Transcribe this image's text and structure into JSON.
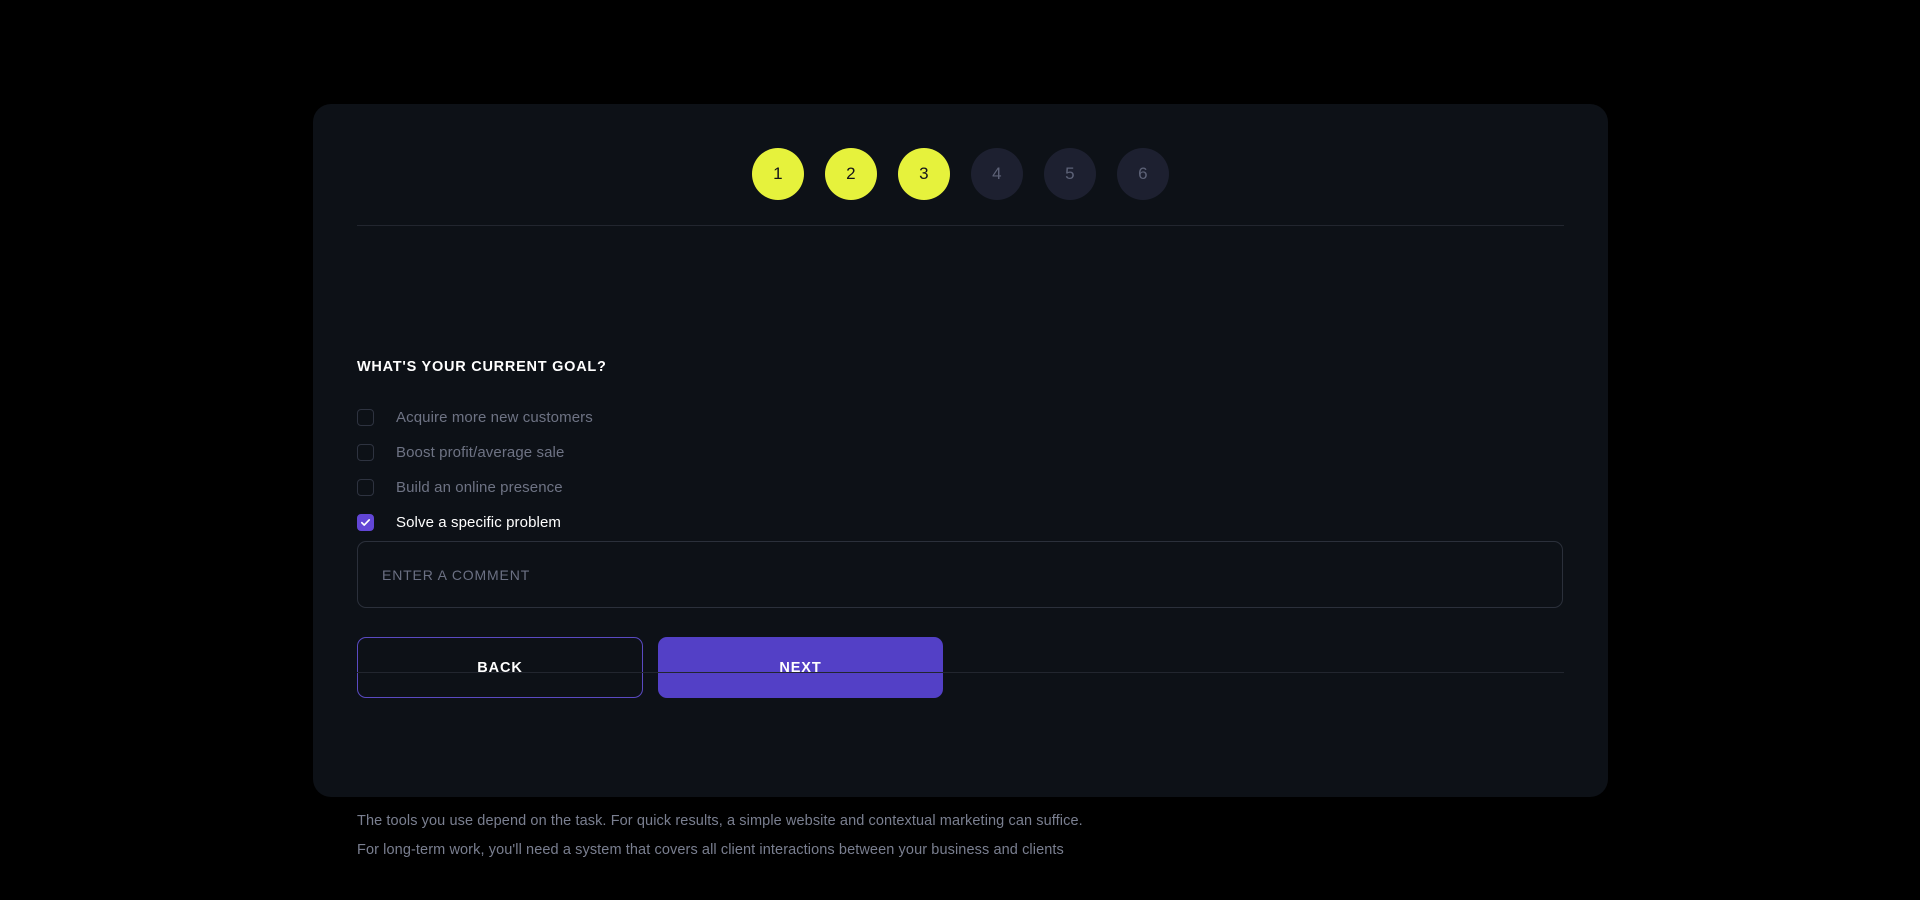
{
  "stepper": {
    "steps": [
      {
        "label": "1",
        "state": "done"
      },
      {
        "label": "2",
        "state": "done"
      },
      {
        "label": "3",
        "state": "done"
      },
      {
        "label": "4",
        "state": "todo"
      },
      {
        "label": "5",
        "state": "todo"
      },
      {
        "label": "6",
        "state": "todo"
      }
    ],
    "active_color": "#e6f23c",
    "inactive_color": "#1d2030"
  },
  "form": {
    "heading": "WHAT'S YOUR CURRENT GOAL?",
    "options": [
      {
        "label": "Acquire more new customers",
        "checked": false
      },
      {
        "label": "Boost profit/average sale",
        "checked": false
      },
      {
        "label": "Build an online presence",
        "checked": false
      },
      {
        "label": "Solve a specific problem",
        "checked": true
      }
    ],
    "comment": {
      "value": "",
      "placeholder": "ENTER A COMMENT"
    },
    "buttons": {
      "back": "BACK",
      "next": "NEXT"
    },
    "accent_color": "#5340c6",
    "checked_color": "#6246d6"
  },
  "footer": {
    "line1": "The tools you use depend on the task. For quick results, a simple website and contextual marketing can suffice.",
    "line2": "For long-term work, you'll need a system that covers all client interactions between your business and clients"
  }
}
